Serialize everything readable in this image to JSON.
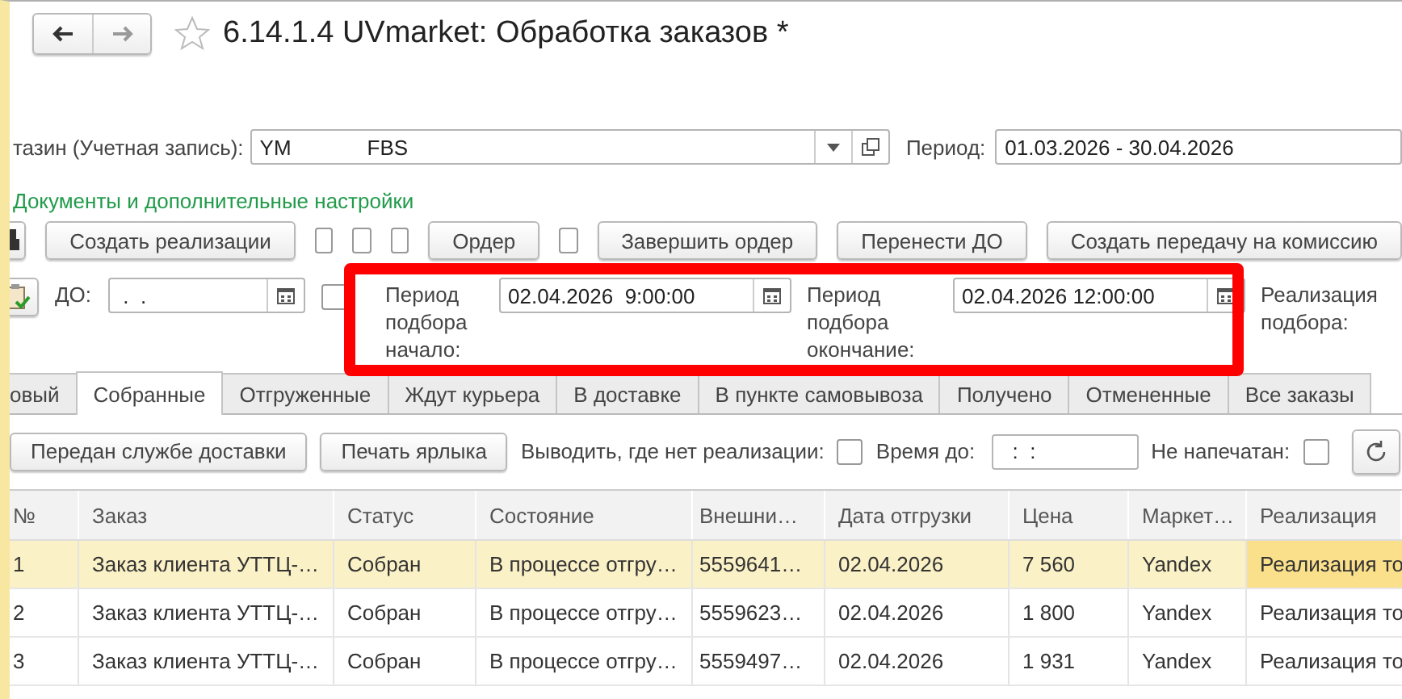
{
  "window": {
    "title": "6.14.1.4 UVmarket: Обработка заказов *",
    "favorite": false
  },
  "account": {
    "label": "тазин (Учетная запись):",
    "value": "YM             FBS"
  },
  "period": {
    "label": "Период:",
    "value": "01.03.2026 - 30.04.2026"
  },
  "settings_link": "Документы и дополнительные настройки",
  "toolbar": [
    {
      "kind": "icon"
    },
    {
      "kind": "button",
      "label": "Создать реализации"
    },
    {
      "kind": "checkbox",
      "checked": false
    },
    {
      "kind": "checkbox",
      "checked": false
    },
    {
      "kind": "checkbox",
      "checked": false
    },
    {
      "kind": "button",
      "label": "Ордер"
    },
    {
      "kind": "checkbox",
      "checked": false
    },
    {
      "kind": "button",
      "label": "Завершить ордер"
    },
    {
      "kind": "button",
      "label": "Перенести ДО"
    },
    {
      "kind": "button",
      "label": "Создать передачу на комиссию"
    }
  ],
  "filters": [
    {
      "kind": "icon"
    },
    {
      "kind": "label",
      "text": "ДО:"
    },
    {
      "kind": "date",
      "value": " .  ."
    },
    {
      "kind": "checkbox",
      "checked": false
    },
    {
      "kind": "label",
      "text": "Период подбора начало:"
    },
    {
      "kind": "date",
      "value": "02.04.2026  9:00:00"
    },
    {
      "kind": "label",
      "text": "Период подбора окончание:"
    },
    {
      "kind": "date",
      "value": "02.04.2026 12:00:00"
    },
    {
      "kind": "label",
      "text": "Реализация подбора:"
    }
  ],
  "tabs": [
    {
      "label": "овый",
      "selected": false
    },
    {
      "label": "Собранные",
      "selected": true
    },
    {
      "label": "Отгруженные",
      "selected": false
    },
    {
      "label": "Ждут курьера",
      "selected": false
    },
    {
      "label": "В доставке",
      "selected": false
    },
    {
      "label": "В пункте самовывоза",
      "selected": false
    },
    {
      "label": "Получено",
      "selected": false
    },
    {
      "label": "Отмененные",
      "selected": false
    },
    {
      "label": "Все заказы",
      "selected": false
    }
  ],
  "actions": [
    {
      "kind": "button",
      "label": "Передан службе доставки"
    },
    {
      "kind": "button",
      "label": "Печать ярлыка"
    },
    {
      "kind": "label",
      "text": "Выводить, где нет реализации:"
    },
    {
      "kind": "checkbox",
      "checked": false
    },
    {
      "kind": "label",
      "text": "Время до:"
    },
    {
      "kind": "field",
      "value": "  :  :"
    },
    {
      "kind": "label",
      "text": "Не напечатан:"
    },
    {
      "kind": "checkbox",
      "checked": false
    },
    {
      "kind": "refresh"
    }
  ],
  "table": {
    "columns": [
      "№",
      "Заказ",
      "Статус",
      "Состояние",
      "Внешни…",
      "Дата отгрузки",
      "Цена",
      "Маркет…",
      "Реализация"
    ],
    "rows": [
      {
        "selected": true,
        "cells": [
          "1",
          "Заказ клиента УТТЦ-…",
          "Собран",
          "В процессе отгру…",
          "5559641…",
          "02.04.2026",
          "7 560",
          "Yandex",
          "Реализация то"
        ]
      },
      {
        "selected": false,
        "cells": [
          "2",
          "Заказ клиента УТТЦ-…",
          "Собран",
          "В процессе отгру…",
          "5559623…",
          "02.04.2026",
          "1 800",
          "Yandex",
          "Реализация то"
        ]
      },
      {
        "selected": false,
        "cells": [
          "3",
          "Заказ клиента УТТЦ-…",
          "Собран",
          "В процессе отгру…",
          "5559497…",
          "02.04.2026",
          "1 931",
          "Yandex",
          "Реализация то"
        ]
      }
    ]
  }
}
